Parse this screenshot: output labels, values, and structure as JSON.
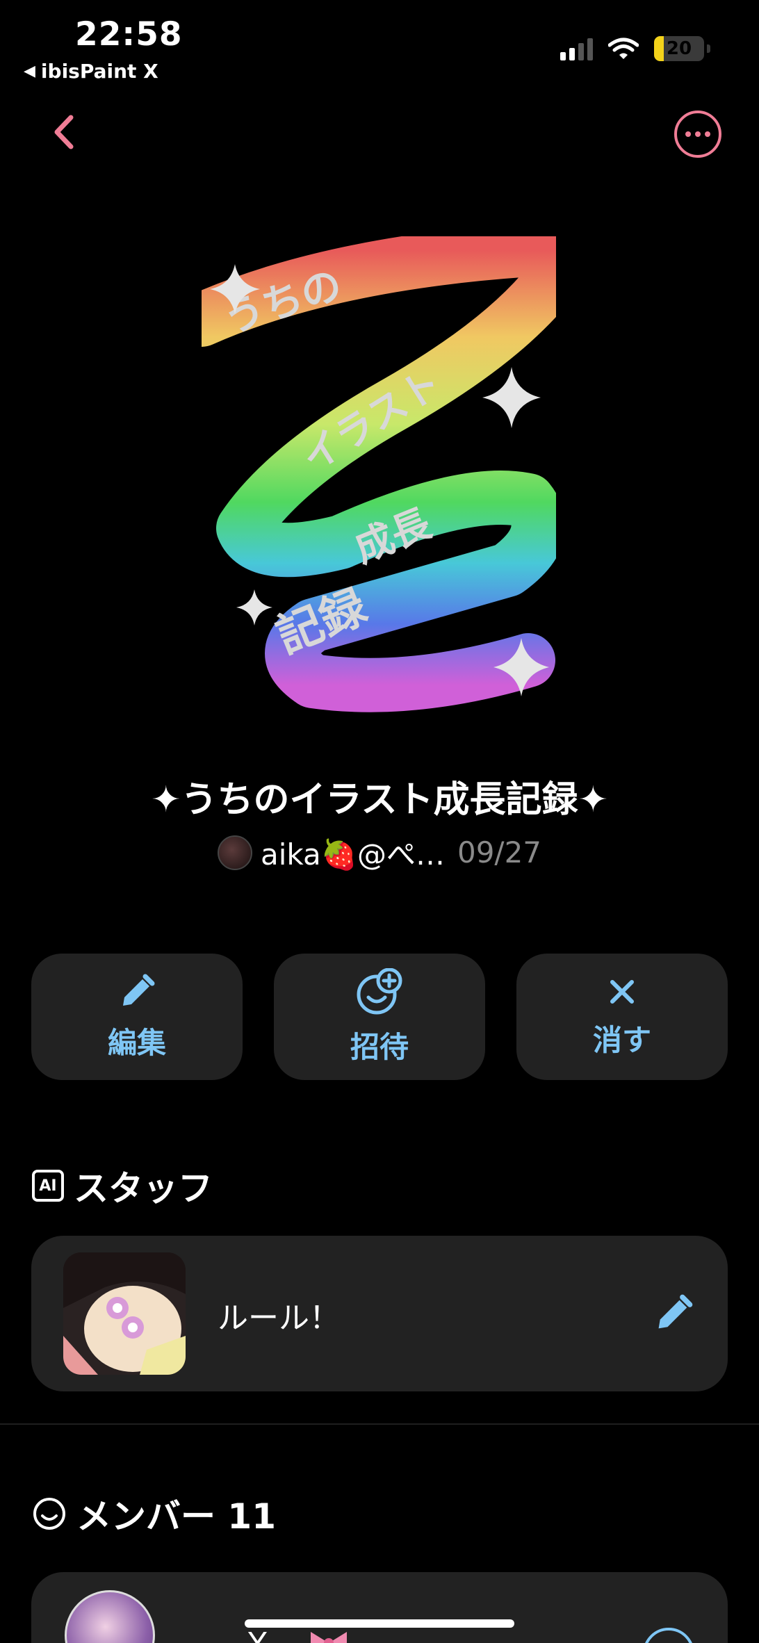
{
  "status_bar": {
    "time": "22:58",
    "back_app": "ibisPaint X",
    "battery_level": "20",
    "battery_fraction": 0.2,
    "signal_bars": 2
  },
  "nav": {
    "back_icon": "chevron-left-icon",
    "more_icon": "more-horizontal-icon",
    "accent_color": "#f07d96"
  },
  "cover": {
    "lines": [
      "うちの",
      "イラスト",
      "成長",
      "記録"
    ]
  },
  "project": {
    "title": "✦うちのイラスト成長記録✦",
    "author": "aika🍓@ぺ…",
    "date": "09/27"
  },
  "actions": [
    {
      "label": "編集",
      "icon": "pencil-icon"
    },
    {
      "label": "招待",
      "icon": "invite-icon"
    },
    {
      "label": "消す",
      "icon": "close-icon"
    }
  ],
  "staff_section": {
    "badge": "AI",
    "title": "スタッフ",
    "item_label": "ルール！"
  },
  "member_section": {
    "title": "メンバー 11",
    "first_member_name": "Y"
  },
  "colors": {
    "accent_blue": "#7fc6f5",
    "card_bg": "#222222"
  }
}
